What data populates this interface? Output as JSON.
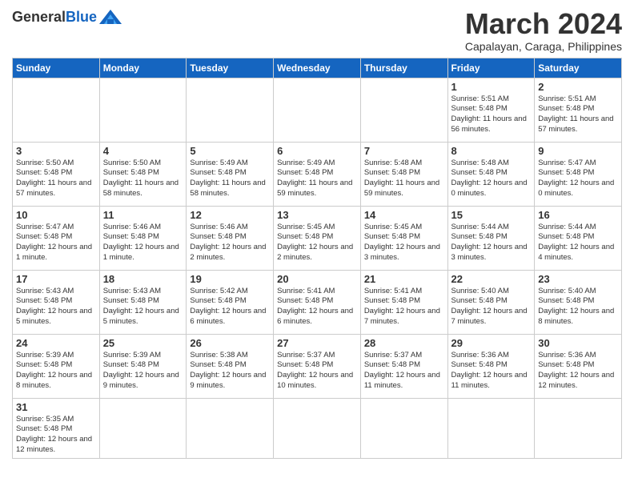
{
  "header": {
    "logo_general": "General",
    "logo_blue": "Blue",
    "month_title": "March 2024",
    "subtitle": "Capalayan, Caraga, Philippines"
  },
  "weekdays": [
    "Sunday",
    "Monday",
    "Tuesday",
    "Wednesday",
    "Thursday",
    "Friday",
    "Saturday"
  ],
  "weeks": [
    [
      {
        "day": "",
        "info": ""
      },
      {
        "day": "",
        "info": ""
      },
      {
        "day": "",
        "info": ""
      },
      {
        "day": "",
        "info": ""
      },
      {
        "day": "",
        "info": ""
      },
      {
        "day": "1",
        "info": "Sunrise: 5:51 AM\nSunset: 5:48 PM\nDaylight: 11 hours and 56 minutes."
      },
      {
        "day": "2",
        "info": "Sunrise: 5:51 AM\nSunset: 5:48 PM\nDaylight: 11 hours and 57 minutes."
      }
    ],
    [
      {
        "day": "3",
        "info": "Sunrise: 5:50 AM\nSunset: 5:48 PM\nDaylight: 11 hours and 57 minutes."
      },
      {
        "day": "4",
        "info": "Sunrise: 5:50 AM\nSunset: 5:48 PM\nDaylight: 11 hours and 58 minutes."
      },
      {
        "day": "5",
        "info": "Sunrise: 5:49 AM\nSunset: 5:48 PM\nDaylight: 11 hours and 58 minutes."
      },
      {
        "day": "6",
        "info": "Sunrise: 5:49 AM\nSunset: 5:48 PM\nDaylight: 11 hours and 59 minutes."
      },
      {
        "day": "7",
        "info": "Sunrise: 5:48 AM\nSunset: 5:48 PM\nDaylight: 11 hours and 59 minutes."
      },
      {
        "day": "8",
        "info": "Sunrise: 5:48 AM\nSunset: 5:48 PM\nDaylight: 12 hours and 0 minutes."
      },
      {
        "day": "9",
        "info": "Sunrise: 5:47 AM\nSunset: 5:48 PM\nDaylight: 12 hours and 0 minutes."
      }
    ],
    [
      {
        "day": "10",
        "info": "Sunrise: 5:47 AM\nSunset: 5:48 PM\nDaylight: 12 hours and 1 minute."
      },
      {
        "day": "11",
        "info": "Sunrise: 5:46 AM\nSunset: 5:48 PM\nDaylight: 12 hours and 1 minute."
      },
      {
        "day": "12",
        "info": "Sunrise: 5:46 AM\nSunset: 5:48 PM\nDaylight: 12 hours and 2 minutes."
      },
      {
        "day": "13",
        "info": "Sunrise: 5:45 AM\nSunset: 5:48 PM\nDaylight: 12 hours and 2 minutes."
      },
      {
        "day": "14",
        "info": "Sunrise: 5:45 AM\nSunset: 5:48 PM\nDaylight: 12 hours and 3 minutes."
      },
      {
        "day": "15",
        "info": "Sunrise: 5:44 AM\nSunset: 5:48 PM\nDaylight: 12 hours and 3 minutes."
      },
      {
        "day": "16",
        "info": "Sunrise: 5:44 AM\nSunset: 5:48 PM\nDaylight: 12 hours and 4 minutes."
      }
    ],
    [
      {
        "day": "17",
        "info": "Sunrise: 5:43 AM\nSunset: 5:48 PM\nDaylight: 12 hours and 5 minutes."
      },
      {
        "day": "18",
        "info": "Sunrise: 5:43 AM\nSunset: 5:48 PM\nDaylight: 12 hours and 5 minutes."
      },
      {
        "day": "19",
        "info": "Sunrise: 5:42 AM\nSunset: 5:48 PM\nDaylight: 12 hours and 6 minutes."
      },
      {
        "day": "20",
        "info": "Sunrise: 5:41 AM\nSunset: 5:48 PM\nDaylight: 12 hours and 6 minutes."
      },
      {
        "day": "21",
        "info": "Sunrise: 5:41 AM\nSunset: 5:48 PM\nDaylight: 12 hours and 7 minutes."
      },
      {
        "day": "22",
        "info": "Sunrise: 5:40 AM\nSunset: 5:48 PM\nDaylight: 12 hours and 7 minutes."
      },
      {
        "day": "23",
        "info": "Sunrise: 5:40 AM\nSunset: 5:48 PM\nDaylight: 12 hours and 8 minutes."
      }
    ],
    [
      {
        "day": "24",
        "info": "Sunrise: 5:39 AM\nSunset: 5:48 PM\nDaylight: 12 hours and 8 minutes."
      },
      {
        "day": "25",
        "info": "Sunrise: 5:39 AM\nSunset: 5:48 PM\nDaylight: 12 hours and 9 minutes."
      },
      {
        "day": "26",
        "info": "Sunrise: 5:38 AM\nSunset: 5:48 PM\nDaylight: 12 hours and 9 minutes."
      },
      {
        "day": "27",
        "info": "Sunrise: 5:37 AM\nSunset: 5:48 PM\nDaylight: 12 hours and 10 minutes."
      },
      {
        "day": "28",
        "info": "Sunrise: 5:37 AM\nSunset: 5:48 PM\nDaylight: 12 hours and 11 minutes."
      },
      {
        "day": "29",
        "info": "Sunrise: 5:36 AM\nSunset: 5:48 PM\nDaylight: 12 hours and 11 minutes."
      },
      {
        "day": "30",
        "info": "Sunrise: 5:36 AM\nSunset: 5:48 PM\nDaylight: 12 hours and 12 minutes."
      }
    ],
    [
      {
        "day": "31",
        "info": "Sunrise: 5:35 AM\nSunset: 5:48 PM\nDaylight: 12 hours and 12 minutes."
      },
      {
        "day": "",
        "info": ""
      },
      {
        "day": "",
        "info": ""
      },
      {
        "day": "",
        "info": ""
      },
      {
        "day": "",
        "info": ""
      },
      {
        "day": "",
        "info": ""
      },
      {
        "day": "",
        "info": ""
      }
    ]
  ]
}
